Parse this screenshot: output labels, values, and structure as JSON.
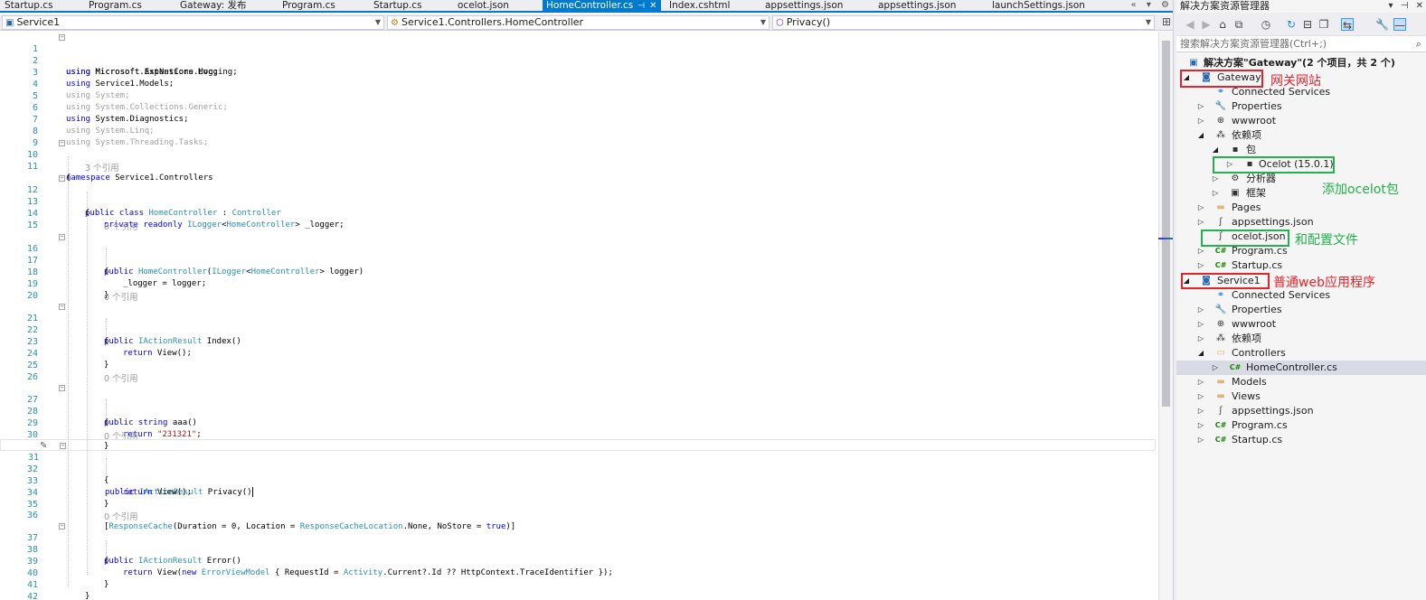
{
  "tabs": [
    {
      "label": "Startup.cs",
      "active": false
    },
    {
      "label": "Program.cs",
      "active": false
    },
    {
      "label": "Gateway: 发布",
      "active": false
    },
    {
      "label": "Program.cs",
      "active": false
    },
    {
      "label": "Startup.cs",
      "active": false
    },
    {
      "label": "ocelot.json",
      "active": false
    },
    {
      "label": "HomeController.cs",
      "active": true,
      "pin": "⊣",
      "close": "✕"
    },
    {
      "label": "Index.cshtml",
      "active": false
    },
    {
      "label": "appsettings.json",
      "active": false
    },
    {
      "label": "appsettings.json",
      "active": false
    },
    {
      "label": "launchSettings.json",
      "active": false
    }
  ],
  "tab_tools": {
    "overflow": "«",
    "dropdown": "▾",
    "settings": "⚙"
  },
  "navbar": {
    "project": "Service1",
    "type": "Service1.Controllers.HomeController",
    "member": "Privacy()"
  },
  "editor": {
    "line_numbers": [
      "1",
      "2",
      "3",
      "4",
      "5",
      "6",
      "7",
      "8",
      "9",
      "10",
      "11",
      "12",
      "13",
      "14",
      "15",
      "16",
      "17",
      "18",
      "19",
      "20",
      "21",
      "22",
      "23",
      "24",
      "25",
      "26",
      "27",
      "28",
      "29",
      "30",
      "31",
      "32",
      "33",
      "34",
      "35",
      "36",
      "37",
      "38",
      "39",
      "40",
      "41",
      "42",
      "43"
    ],
    "lens": {
      "l12": "3 个引用",
      "l16": "0 个引用",
      "l21": "0 个引用",
      "l27": "0 个引用",
      "l31": "0 个引用",
      "l37": "0 个引用"
    },
    "code": {
      "u1a": "using",
      "u1b": " Microsoft.AspNetCore.Mvc;",
      "u2a": "using",
      "u2b": " Microsoft.Extensions.Logging;",
      "u3a": "using",
      "u3b": " Service1.Models;",
      "u4": "using System;",
      "u5": "using System.Collections.Generic;",
      "u6a": "using",
      "u6b": " System.Diagnostics;",
      "u7": "using System.Linq;",
      "u8": "using System.Threading.Tasks;",
      "ns_kw": "namespace",
      "ns_name": " Service1.Controllers",
      "brace_open": "{",
      "brace_close": "}",
      "class_kw": "public class ",
      "class_name": "HomeController",
      "class_colon": " : ",
      "class_base": "Controller",
      "f_kw": "private readonly ",
      "f_type": "ILogger",
      "f_lt": "<",
      "f_targ": "HomeController",
      "f_rest": "> _logger;",
      "ctor_kw": "public ",
      "ctor_name": "HomeController",
      "ctor_p1": "(",
      "ctor_type": "ILogger",
      "ctor_lt": "<",
      "ctor_targ": "HomeController",
      "ctor_rest": "> logger)",
      "assign": "_logger = logger;",
      "idx_kw": "public ",
      "idx_type": "IActionResult",
      "idx_name": " Index()",
      "ret_kw": "return",
      "ret_view": " View();",
      "aaa_kw": "public string ",
      "aaa_name": "aaa()",
      "aaa_str": "\"231321\"",
      "aaa_semi": ";",
      "pri_kw": "public ",
      "pri_type": "IActionResult",
      "pri_name": " Privacy()",
      "attr_open": "[",
      "attr_name": "ResponseCache",
      "attr_a": "(Duration = 0, Location = ",
      "attr_loc": "ResponseCacheLocation",
      "attr_b": ".None, NoStore = ",
      "attr_true": "true",
      "attr_close": ")]",
      "err_kw": "public ",
      "err_type": "IActionResult",
      "err_name": " Error()",
      "er_ret": "return",
      "er_view": " View(",
      "er_new": "new",
      "er_type": " ErrorViewModel",
      "er_a": " { RequestId = ",
      "er_act": "Activity",
      "er_b": ".Current?.Id ?? HttpContext.TraceIdentifier });"
    }
  },
  "solution_explorer": {
    "title": "解决方案资源管理器",
    "title_controls": [
      "▾",
      "⊣",
      "✕"
    ],
    "search_placeholder": "搜索解决方案资源管理器(Ctrl+;)",
    "search_icon": "⌕",
    "toolbar_icons": [
      "back-icon",
      "forward-icon",
      "home-icon",
      "switch-views-icon",
      "history-icon",
      "refresh-icon",
      "collapse-all-icon",
      "show-all-files-icon",
      "properties-icon",
      "preview-icon"
    ],
    "tree": {
      "solution": "解决方案\"Gateway\"(2 个项目，共 2 个)",
      "gateway": "Gateway",
      "gw_connected": "Connected Services",
      "gw_properties": "Properties",
      "gw_wwwroot": "wwwroot",
      "gw_deps": "依赖项",
      "gw_pkg": "包",
      "gw_ocelot": "Ocelot (15.0.1)",
      "gw_analyzers": "分析器",
      "gw_frameworks": "框架",
      "gw_pages": "Pages",
      "gw_appsettings": "appsettings.json",
      "gw_ocelotjson": "ocelot.json",
      "gw_program": "Program.cs",
      "gw_startup": "Startup.cs",
      "service1": "Service1",
      "s1_connected": "Connected Services",
      "s1_properties": "Properties",
      "s1_wwwroot": "wwwroot",
      "s1_deps": "依赖项",
      "s1_controllers": "Controllers",
      "s1_homecontroller": "HomeController.cs",
      "s1_models": "Models",
      "s1_views": "Views",
      "s1_appsettings": "appsettings.json",
      "s1_program": "Program.cs",
      "s1_startup": "Startup.cs"
    }
  },
  "annotations": {
    "gateway_note": "网关网站",
    "ocelot_note": "添加ocelot包",
    "config_note": "和配置文件",
    "service_note": "普通web应用程序"
  },
  "colors": {
    "accent": "#007acc",
    "keyword": "#0000ff",
    "type": "#2b91af",
    "string": "#a31515",
    "annotation_red": "#e3242b",
    "annotation_green": "#22b14c"
  }
}
